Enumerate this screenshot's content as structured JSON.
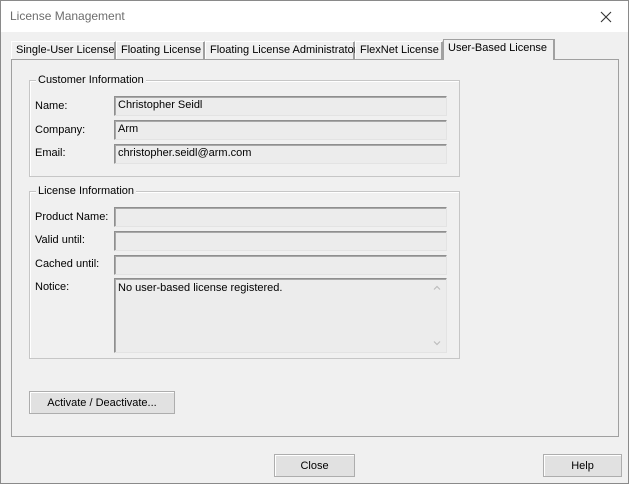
{
  "window": {
    "title": "License Management"
  },
  "tabs": [
    {
      "label": "Single-User License"
    },
    {
      "label": "Floating License"
    },
    {
      "label": "Floating License Administrator"
    },
    {
      "label": "FlexNet License"
    },
    {
      "label": "User-Based License"
    }
  ],
  "customer": {
    "group_title": "Customer Information",
    "name_label": "Name:",
    "name_value": "Christopher Seidl",
    "company_label": "Company:",
    "company_value": "Arm",
    "email_label": "Email:",
    "email_value": "christopher.seidl@arm.com"
  },
  "license": {
    "group_title": "License Information",
    "product_label": "Product Name:",
    "product_value": "",
    "valid_label": "Valid until:",
    "valid_value": "",
    "cached_label": "Cached until:",
    "cached_value": "",
    "notice_label": "Notice:",
    "notice_value": "No user-based license registered."
  },
  "buttons": {
    "activate": "Activate / Deactivate...",
    "close": "Close",
    "help": "Help"
  },
  "icons": {
    "close": "close-icon",
    "scroll_up": "chevron-up-icon",
    "scroll_down": "chevron-down-icon"
  }
}
